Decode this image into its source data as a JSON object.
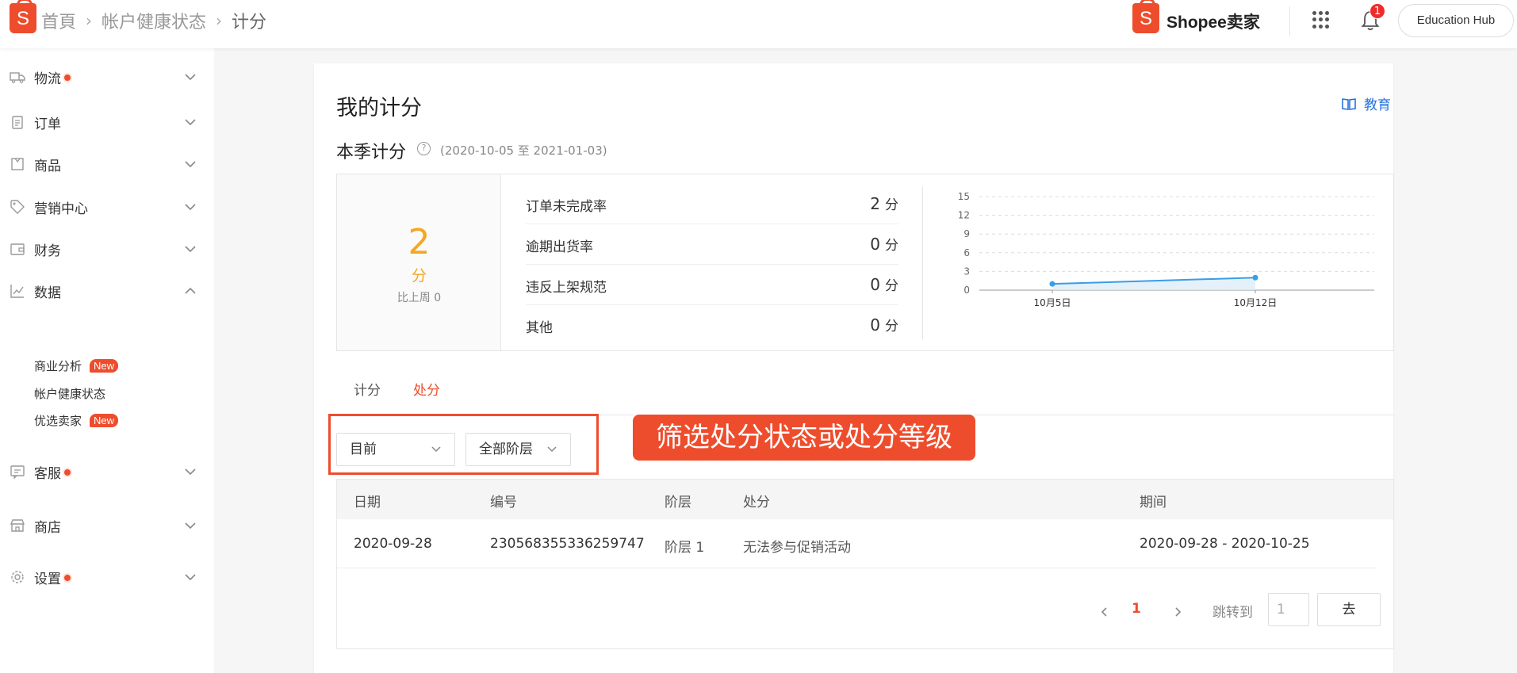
{
  "colors": {
    "brand": "#ee4d2d",
    "score": "#f5a623",
    "link": "#2673dd",
    "chart_line": "#3a9de8"
  },
  "header": {
    "logo_letter": "S",
    "breadcrumb": [
      "首頁",
      "帐户健康状态",
      "计分"
    ],
    "brand_name": "Shopee卖家",
    "notification_count": "1",
    "edu_hub": "Education Hub"
  },
  "sidebar": {
    "items": [
      {
        "label": "物流",
        "icon": "truck-icon",
        "dot": true
      },
      {
        "label": "订单",
        "icon": "clipboard-icon",
        "dot": false
      },
      {
        "label": "商品",
        "icon": "box-icon",
        "dot": false
      },
      {
        "label": "营销中心",
        "icon": "tag-icon",
        "dot": false
      },
      {
        "label": "财务",
        "icon": "wallet-icon",
        "dot": false
      },
      {
        "label": "数据",
        "icon": "chart-icon",
        "dot": false,
        "expanded": true
      },
      {
        "label": "客服",
        "icon": "chat-icon",
        "dot": true
      },
      {
        "label": "商店",
        "icon": "shop-icon",
        "dot": false
      },
      {
        "label": "设置",
        "icon": "gear-icon",
        "dot": true
      }
    ],
    "data_sub": [
      {
        "label": "商业分析",
        "badge": "New"
      },
      {
        "label": "帐户健康状态",
        "badge": ""
      },
      {
        "label": "优选卖家",
        "badge": "New"
      }
    ]
  },
  "main": {
    "title": "我的计分",
    "edu_link": "教育",
    "season_title": "本季计分",
    "season_range": "(2020-10-05 至 2021-01-03)",
    "score": {
      "value": "2",
      "unit": "分",
      "compare": "比上周 0"
    },
    "metrics": [
      {
        "label": "订单未完成率",
        "value": "2",
        "unit": "分"
      },
      {
        "label": "逾期出货率",
        "value": "0",
        "unit": "分"
      },
      {
        "label": "违反上架规范",
        "value": "0",
        "unit": "分"
      },
      {
        "label": "其他",
        "value": "0",
        "unit": "分"
      }
    ],
    "tabs": [
      {
        "label": "计分",
        "active": false
      },
      {
        "label": "处分",
        "active": true
      }
    ],
    "filters": {
      "status": "目前",
      "tier": "全部阶层"
    },
    "callout": "筛选处分状态或处分等级",
    "table": {
      "headers": [
        "日期",
        "编号",
        "阶层",
        "处分",
        "期间"
      ],
      "rows": [
        [
          "2020-09-28",
          "230568355336259747",
          "阶层 1",
          "无法参与促销活动",
          "2020-09-28 - 2020-10-25"
        ]
      ]
    },
    "pagination": {
      "current": "1",
      "jump_label": "跳转到",
      "jump_placeholder": "1",
      "go": "去"
    }
  },
  "chart_data": {
    "type": "line",
    "x": [
      "10月5日",
      "10月12日"
    ],
    "series": [
      {
        "values": [
          1,
          2
        ]
      }
    ],
    "ylim": [
      0,
      15
    ],
    "yticks": [
      0,
      3,
      6,
      9,
      12,
      15
    ],
    "grid": true
  }
}
